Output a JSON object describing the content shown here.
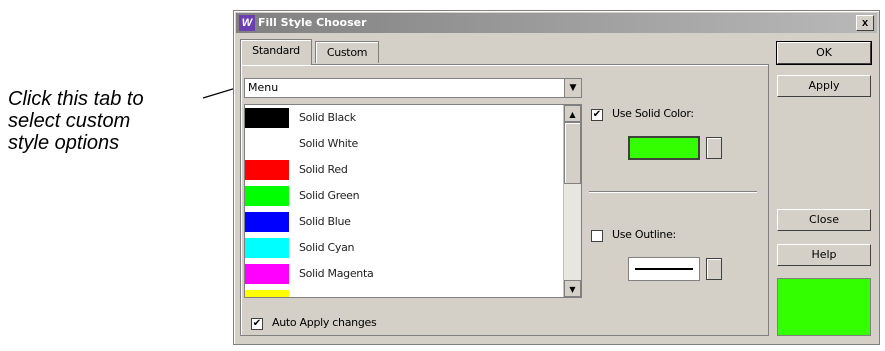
{
  "annotation": {
    "lines": [
      "Click this tab to",
      "select custom",
      "style options"
    ]
  },
  "dialog": {
    "title": "Fill Style Chooser",
    "close_glyph": "x",
    "tabs": {
      "standard": "Standard",
      "custom": "Custom"
    },
    "menu": {
      "value": "Menu",
      "arrow": "▼"
    },
    "list_items": [
      {
        "label": "Solid Black",
        "color": "#000000"
      },
      {
        "label": "Solid White",
        "color": "#ffffff"
      },
      {
        "label": "Solid Red",
        "color": "#ff0000"
      },
      {
        "label": "Solid Green",
        "color": "#00ff00"
      },
      {
        "label": "Solid Blue",
        "color": "#0000ff"
      },
      {
        "label": "Solid Cyan",
        "color": "#00ffff"
      },
      {
        "label": "Solid Magenta",
        "color": "#ff00ff"
      },
      {
        "label": "",
        "color": "#ffff00"
      }
    ],
    "scroll_up": "▲",
    "scroll_down": "▼",
    "use_solid_color": {
      "label": "Use Solid Color:",
      "checked": true,
      "color": "#33ff00"
    },
    "use_outline": {
      "label": "Use Outline:",
      "checked": false
    },
    "auto_apply": {
      "label": "Auto Apply changes",
      "checked": true
    },
    "buttons": {
      "ok": "OK",
      "apply": "Apply",
      "close": "Close",
      "help": "Help"
    },
    "preview_color": "#33ff00"
  }
}
